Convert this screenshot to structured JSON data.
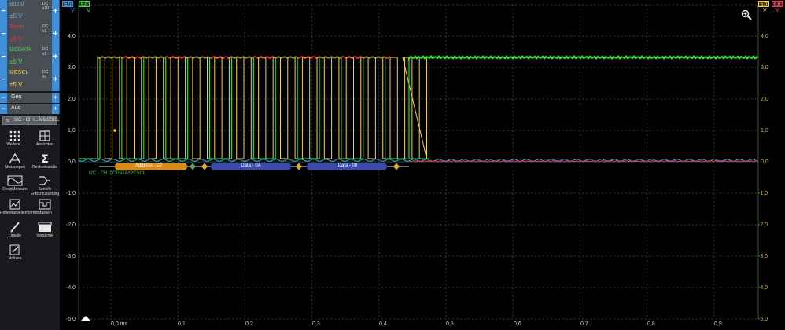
{
  "sidebar": {
    "channels": [
      {
        "name": "Boot0",
        "range": "±5 V",
        "coupling": [
          "DC",
          "x10"
        ],
        "color": "#2d9cf0"
      },
      {
        "name": "Reset",
        "range": "±5 V",
        "coupling": [
          "DC",
          "x1"
        ],
        "color": "#f0364a"
      },
      {
        "name": "I2CDATA",
        "range": "±5 V",
        "coupling": [
          "DC",
          "x1"
        ],
        "color": "#3fe03f"
      },
      {
        "name": "I2CSCL",
        "range": "±5 V",
        "coupling": [
          "DC",
          "x1"
        ],
        "color": "#f5d23a"
      }
    ],
    "generator": {
      "label": "Gen",
      "state": "Aus"
    },
    "decoder": "I2C - Ch I...A/I2CSCL",
    "tools": [
      {
        "label": "Weitere...",
        "icon": "grid-dots-icon"
      },
      {
        "label": "Ansichten",
        "icon": "window-grid-icon"
      },
      {
        "label": "Messungen",
        "icon": "measurements-icon"
      },
      {
        "label": "Rechenkanäle",
        "icon": "sigma-icon"
      },
      {
        "label": "DeepMeasure",
        "icon": "deepmeasure-icon"
      },
      {
        "label": "Serielle Entschlüsselung",
        "icon": "serial-decoding-icon"
      },
      {
        "label": "Referenzwellenformen",
        "icon": "reference-waveform-icon"
      },
      {
        "label": "Masken",
        "icon": "masks-icon"
      },
      {
        "label": "Lineale",
        "icon": "ruler-icon"
      },
      {
        "label": "Vorgänge",
        "icon": "clapperboard-icon"
      },
      {
        "label": "Notizen",
        "icon": "notes-icon"
      }
    ]
  },
  "scope": {
    "top_left": [
      {
        "value": "5,0",
        "unit": "V",
        "color": "#2d9cf0"
      },
      {
        "value": "5,0",
        "unit": "V",
        "color": "#3fe03f"
      }
    ],
    "top_right": [
      {
        "value": "5,0",
        "unit": "V",
        "color": "#f5d23a"
      },
      {
        "value": "5,0",
        "unit": "V",
        "color": "#f0364a"
      }
    ],
    "left_axis": [
      "4,0",
      "3,0",
      "2,0",
      "1,0",
      "0,0",
      "-1,0",
      "-2,0",
      "-3,0",
      "-4,0",
      "-5,0"
    ],
    "right_axis": [
      "4,0",
      "3,0",
      "2,0",
      "1,0",
      "0,0",
      "-1,0",
      "-2,0",
      "-3,0",
      "-4,0",
      "-5,0"
    ],
    "time_axis": [
      "0,0 ms",
      "0,1",
      "0,2",
      "0,3",
      "0,4",
      "0,5",
      "0,6",
      "0,7",
      "0,8",
      "0,9"
    ],
    "decode_label": "I2C - CH I2CDATA/I2CSCL",
    "packets": [
      "Address - 22",
      "Data - 0A",
      "Data - 00"
    ],
    "zoom_icon": "magnifier-icon"
  }
}
